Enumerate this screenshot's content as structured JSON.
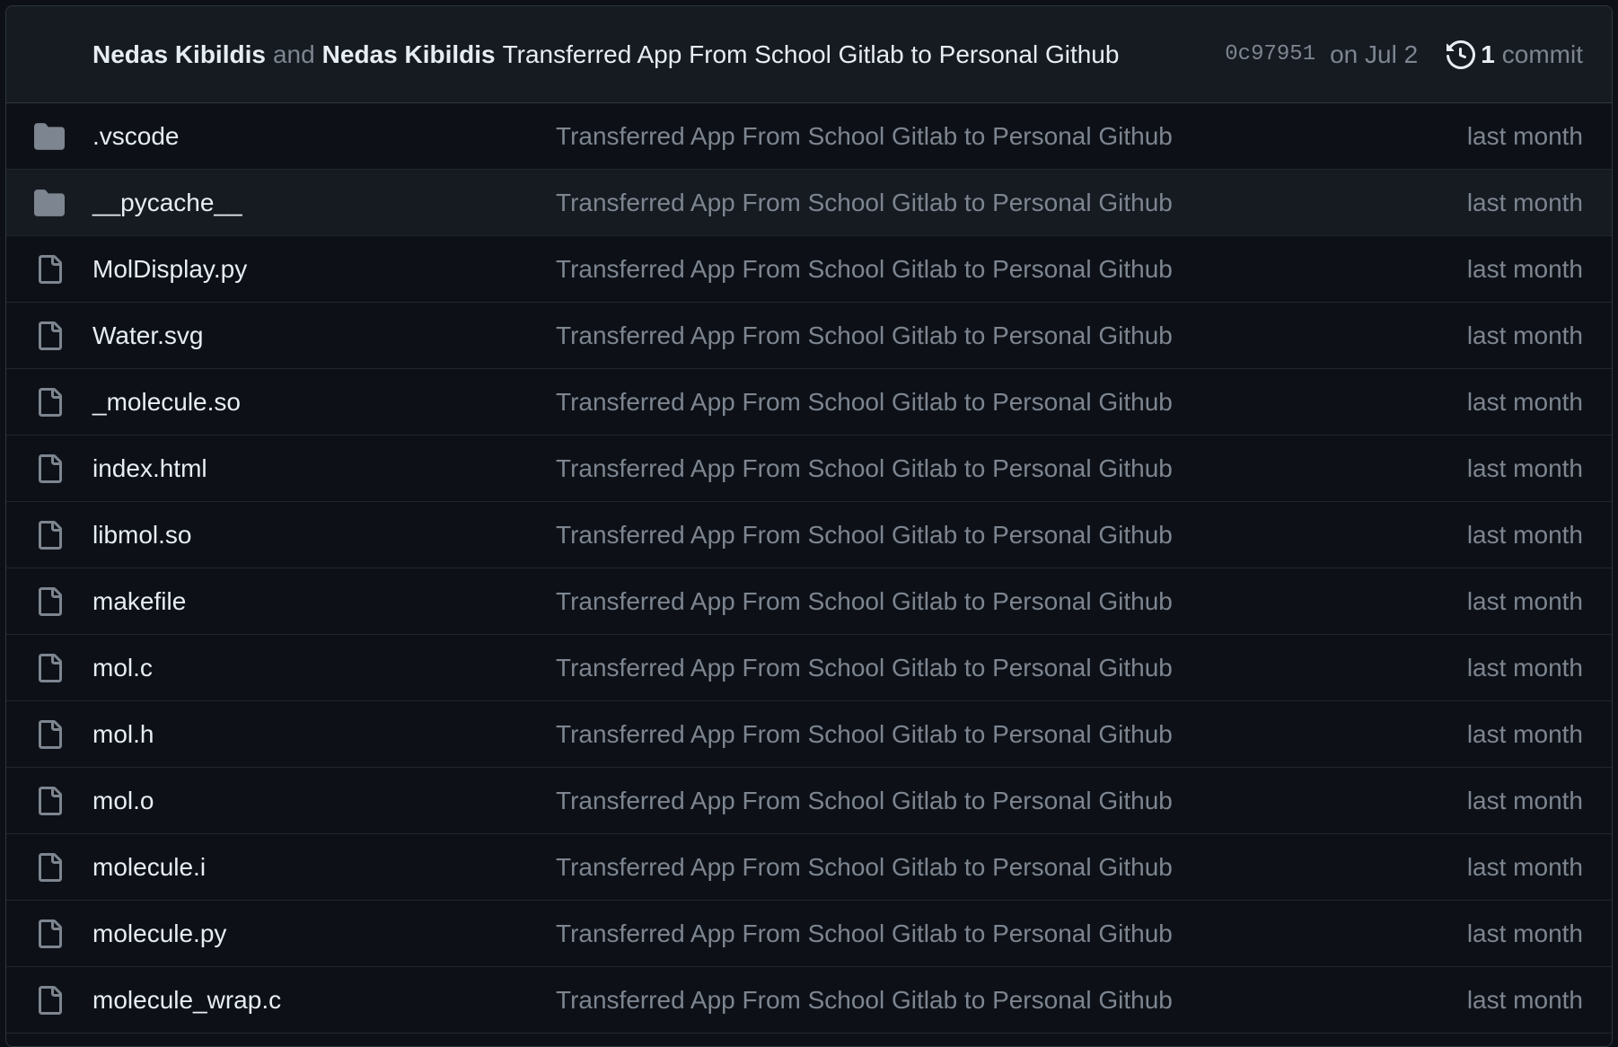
{
  "latest_commit": {
    "author_1": "Nedas Kibildis",
    "connector": "and",
    "author_2": "Nedas Kibildis",
    "message": "Transferred App From School Gitlab to Personal Github",
    "sha": "0c97951",
    "date": "on Jul 2",
    "commit_count": "1",
    "commit_word": "commit",
    "history_icon": "history-icon"
  },
  "colors": {
    "background": "#0d1117",
    "header_bg": "#161b22",
    "border": "#30363d",
    "text": "#e6edf3",
    "muted": "#7d8590",
    "folder_icon": "#7d8590"
  },
  "files": [
    {
      "type": "folder",
      "icon": "folder-icon",
      "name": ".vscode",
      "message": "Transferred App From School Gitlab to Personal Github",
      "age": "last month"
    },
    {
      "type": "folder",
      "icon": "folder-icon",
      "name": "__pycache__",
      "message": "Transferred App From School Gitlab to Personal Github",
      "age": "last month"
    },
    {
      "type": "file",
      "icon": "file-icon",
      "name": "MolDisplay.py",
      "message": "Transferred App From School Gitlab to Personal Github",
      "age": "last month"
    },
    {
      "type": "file",
      "icon": "file-icon",
      "name": "Water.svg",
      "message": "Transferred App From School Gitlab to Personal Github",
      "age": "last month"
    },
    {
      "type": "file",
      "icon": "file-icon",
      "name": "_molecule.so",
      "message": "Transferred App From School Gitlab to Personal Github",
      "age": "last month"
    },
    {
      "type": "file",
      "icon": "file-icon",
      "name": "index.html",
      "message": "Transferred App From School Gitlab to Personal Github",
      "age": "last month"
    },
    {
      "type": "file",
      "icon": "file-icon",
      "name": "libmol.so",
      "message": "Transferred App From School Gitlab to Personal Github",
      "age": "last month"
    },
    {
      "type": "file",
      "icon": "file-icon",
      "name": "makefile",
      "message": "Transferred App From School Gitlab to Personal Github",
      "age": "last month"
    },
    {
      "type": "file",
      "icon": "file-icon",
      "name": "mol.c",
      "message": "Transferred App From School Gitlab to Personal Github",
      "age": "last month"
    },
    {
      "type": "file",
      "icon": "file-icon",
      "name": "mol.h",
      "message": "Transferred App From School Gitlab to Personal Github",
      "age": "last month"
    },
    {
      "type": "file",
      "icon": "file-icon",
      "name": "mol.o",
      "message": "Transferred App From School Gitlab to Personal Github",
      "age": "last month"
    },
    {
      "type": "file",
      "icon": "file-icon",
      "name": "molecule.i",
      "message": "Transferred App From School Gitlab to Personal Github",
      "age": "last month"
    },
    {
      "type": "file",
      "icon": "file-icon",
      "name": "molecule.py",
      "message": "Transferred App From School Gitlab to Personal Github",
      "age": "last month"
    },
    {
      "type": "file",
      "icon": "file-icon",
      "name": "molecule_wrap.c",
      "message": "Transferred App From School Gitlab to Personal Github",
      "age": "last month"
    }
  ]
}
